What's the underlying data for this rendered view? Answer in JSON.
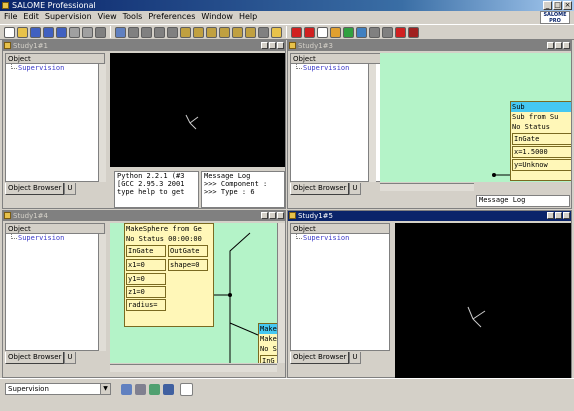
{
  "app": {
    "title": "SALOME Professional",
    "logo_text": "SALOME PRO"
  },
  "menu": [
    "File",
    "Edit",
    "Supervision",
    "View",
    "Tools",
    "Preferences",
    "Window",
    "Help"
  ],
  "toolbar_icons": [
    "new-icon",
    "open-icon",
    "save-icon",
    "undo-icon",
    "redo-icon",
    "copy-icon",
    "paste-icon",
    "dump-icon",
    "view-fit-icon",
    "zoom-icon",
    "zoom-window-icon",
    "pan-icon",
    "rotate-icon",
    "front-icon",
    "back-icon",
    "top-icon",
    "bottom-icon",
    "left-icon",
    "right-icon",
    "reset-icon",
    "cube-icon",
    "red-pin-icon",
    "red-flag-icon",
    "doc-icon",
    "edit-icon",
    "refresh-icon",
    "grid-icon",
    "gear-icon",
    "gear2-icon",
    "stop-icon",
    "record-icon"
  ],
  "windows": {
    "w1": {
      "title": "Study1#1",
      "browser_header": "Object",
      "item": "Supervision",
      "tabs": [
        "Object Browser",
        "U"
      ],
      "python": [
        "Python 2.2.1 (#3",
        "[GCC 2.95.3 2001",
        "type help to get"
      ],
      "msglog": [
        "Message Log",
        ">>> Component :",
        ">>> Type : 6"
      ]
    },
    "w3": {
      "title": "Study1#3",
      "browser_header": "Object",
      "item": "Supervision",
      "tabs": [
        "Object Browser",
        "U"
      ],
      "msglog": [
        "Message Log"
      ],
      "node": {
        "title": "Sub",
        "line1": "Sub from Su",
        "status": "No Status",
        "ingate": "InGate",
        "x": "x=1.5000",
        "y": "y=Unknow"
      }
    },
    "w4": {
      "title": "Study1#4",
      "browser_header": "Object",
      "item": "Supervision",
      "tabs": [
        "Object Browser",
        "U"
      ],
      "node": {
        "line1": "MakeSphere from Ge",
        "status": "No Status 00:00:00",
        "ingate": "InGate",
        "outgate": "OutGate",
        "shape": "shape=0",
        "x1": "x1=0",
        "y1": "y1=0",
        "z1": "z1=0",
        "radius": "radius="
      },
      "node2": {
        "title": "Make",
        "line1": "Make",
        "status": "No S",
        "ingate": "InG"
      }
    },
    "w5": {
      "title": "Study1#5",
      "browser_header": "Object",
      "item": "Supervision",
      "tabs": [
        "Object Browser",
        "U"
      ]
    }
  },
  "status": {
    "combo_value": "Supervision"
  }
}
